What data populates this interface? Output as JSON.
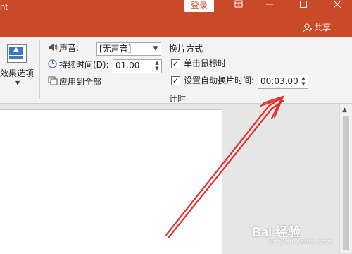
{
  "titlebar": {
    "app_fragment": "nt",
    "login_label": "登录",
    "share_label": "共享",
    "colors": {
      "title_bg": "#c84a29"
    }
  },
  "ribbon": {
    "effects_label": "效果选项",
    "sound_label": "声音:",
    "sound_value": "[无声音]",
    "duration_label": "持续时间(D):",
    "duration_value": "01.00",
    "apply_all_label": "应用到全部",
    "advance_header": "换片方式",
    "on_click_label": "单击鼠标时",
    "after_label": "设置自动换片时间:",
    "after_value": "00:03.00",
    "group_label": "计时",
    "on_click_checked": true,
    "after_checked": true
  },
  "watermark": {
    "brand": "Bai 经验",
    "sub": "jingyan.baidu.com"
  },
  "colors": {
    "arrow": "#e03030"
  }
}
